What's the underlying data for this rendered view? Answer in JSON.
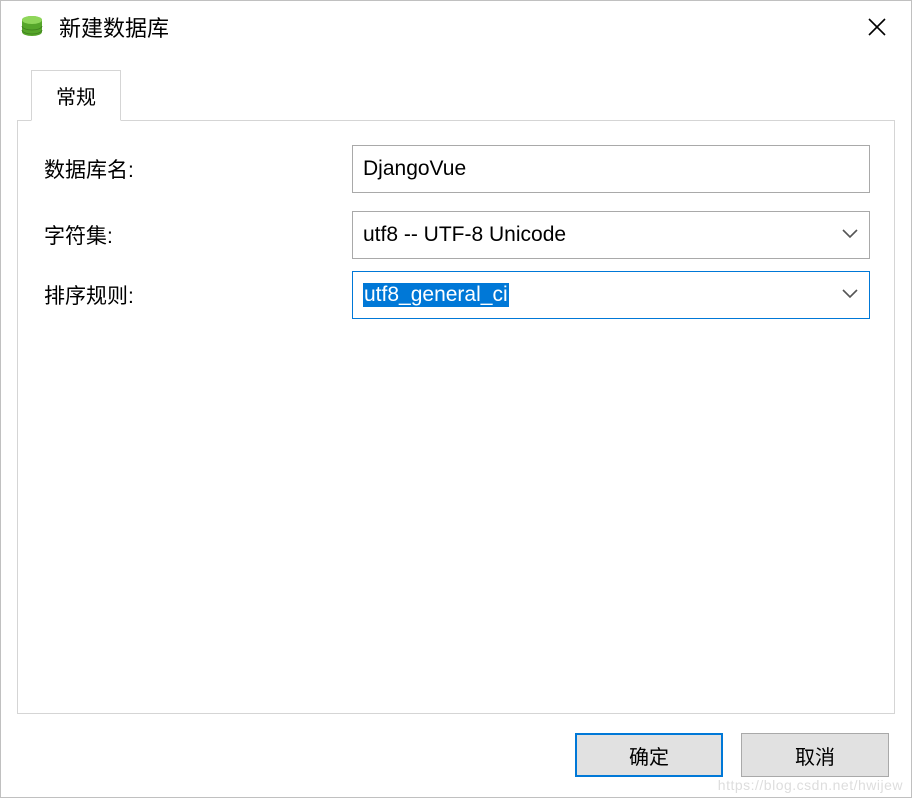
{
  "title": "新建数据库",
  "tab": {
    "general": "常规"
  },
  "form": {
    "db_name_label": "数据库名:",
    "db_name_value": "DjangoVue",
    "charset_label": "字符集:",
    "charset_value": "utf8 -- UTF-8 Unicode",
    "collation_label": "排序规则:",
    "collation_value": "utf8_general_ci"
  },
  "buttons": {
    "ok": "确定",
    "cancel": "取消"
  },
  "watermark": "https://blog.csdn.net/hwijew"
}
